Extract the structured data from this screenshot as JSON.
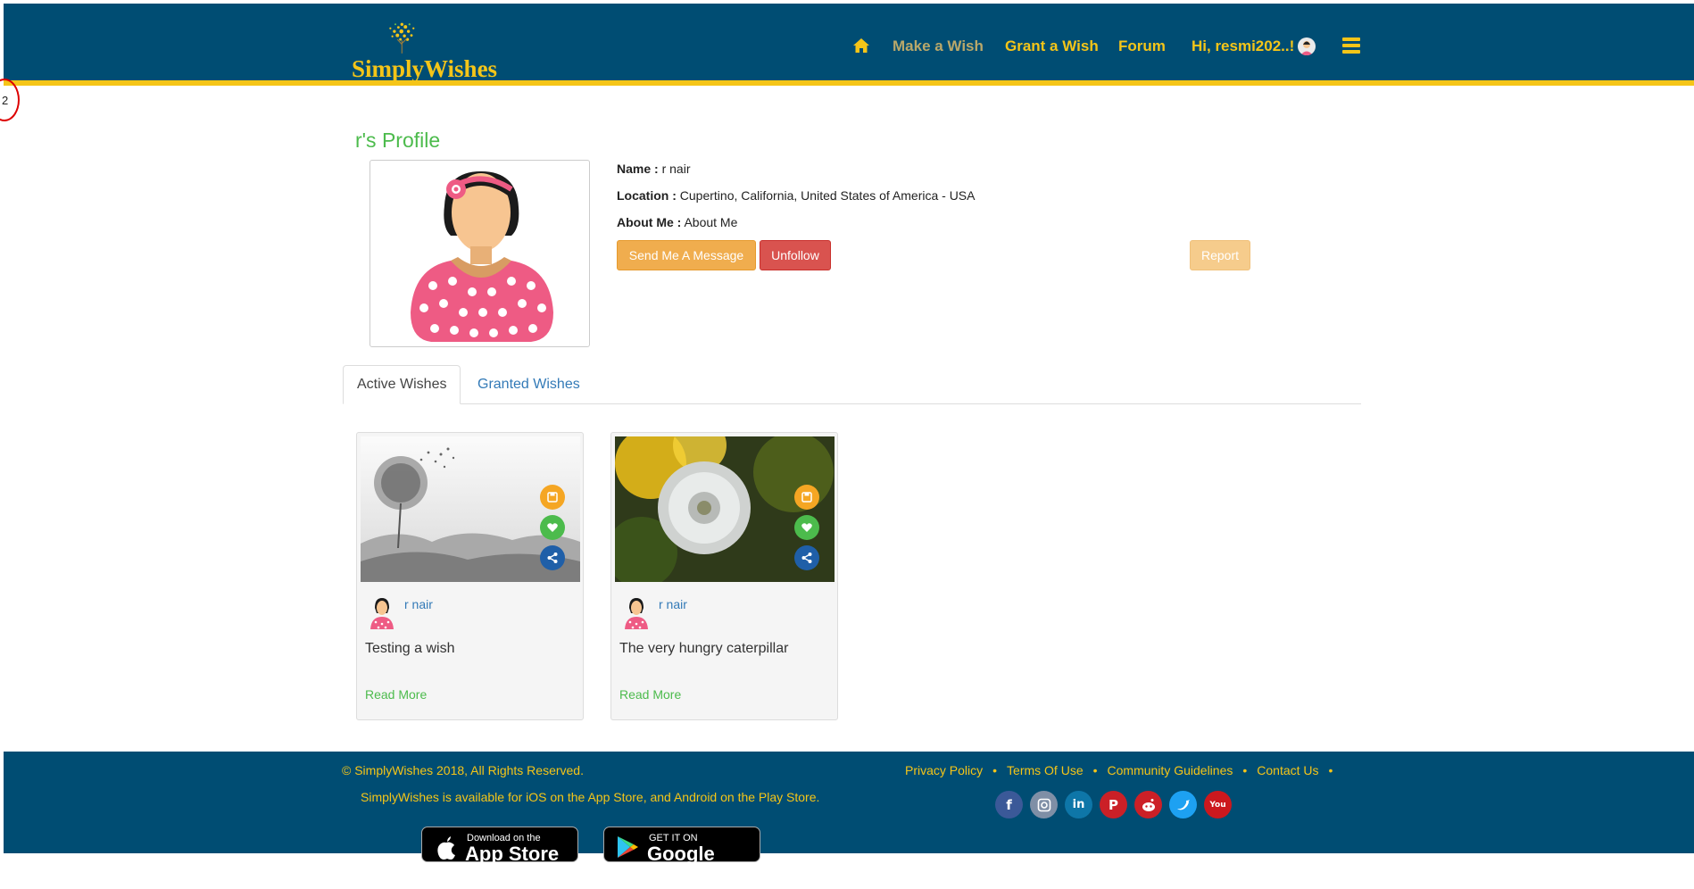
{
  "header": {
    "logo_text": "SimplyWishes",
    "nav": {
      "make_wish": "Make a Wish",
      "grant_wish": "Grant a Wish",
      "forum": "Forum",
      "user_greeting": "Hi, resmi202..!"
    }
  },
  "side_marker": {
    "label": "2"
  },
  "profile": {
    "title": "r's Profile",
    "name_label": "Name :",
    "name_value": "r nair",
    "location_label": "Location :",
    "location_value": "Cupertino, California, United States of America - USA",
    "about_label": "About Me :",
    "about_value": "About Me",
    "buttons": {
      "message": "Send Me A Message",
      "unfollow": "Unfollow",
      "report": "Report"
    }
  },
  "tabs": [
    {
      "label": "Active Wishes",
      "active": true
    },
    {
      "label": "Granted Wishes",
      "active": false
    }
  ],
  "cards": [
    {
      "author": "r nair",
      "title": "Testing a wish",
      "read_more": "Read More",
      "image": "dandelion-mist-bw"
    },
    {
      "author": "r nair",
      "title": "The very hungry caterpillar",
      "read_more": "Read More",
      "image": "dandelion-yellow"
    }
  ],
  "footer": {
    "copyright": "© SimplyWishes 2018, All Rights Reserved.",
    "availability": "SimplyWishes is available for iOS on the App Store, and Android on the Play Store.",
    "links": [
      "Privacy Policy",
      "Terms Of Use",
      "Community Guidelines",
      "Contact Us"
    ],
    "social": [
      "facebook-icon",
      "instagram-icon",
      "linkedin-icon",
      "pinterest-icon",
      "reddit-icon",
      "twitter-icon",
      "youtube-icon"
    ],
    "stores": {
      "apple_small": "Download on the",
      "apple_big": "App Store",
      "google_small": "GET IT ON",
      "google_big": "Google Play"
    }
  },
  "colors": {
    "header_bg": "#004d73",
    "accent_yellow": "#f5c518",
    "green": "#4cbb4c",
    "link_blue": "#337ab7",
    "orange": "#f0ad4e",
    "red": "#d9534f"
  }
}
